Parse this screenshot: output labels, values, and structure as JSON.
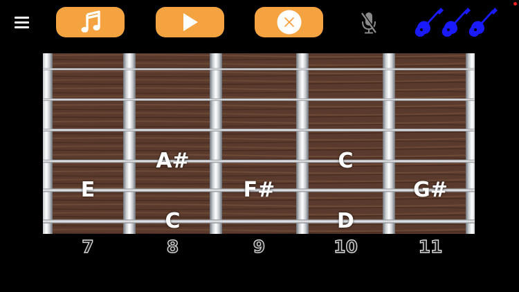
{
  "colors": {
    "accent": "#f4a340",
    "guitar_icons": "#1a1aff",
    "fretboard_wood": "#5a3a2c",
    "background": "#000000",
    "corner_dot": "#ff2222"
  },
  "toolbar": {
    "icons": {
      "menu": "menu-icon",
      "music": "music-note-icon",
      "play": "play-icon",
      "clear": "close-icon",
      "microphone": "microphone-muted-icon",
      "guitars": "electric-guitar-icon"
    }
  },
  "fretboard": {
    "strings": 6,
    "fret_numbers": [
      "7",
      "8",
      "9",
      "10",
      "11"
    ],
    "notes": [
      {
        "label": "A#",
        "fret": 8,
        "string": 4
      },
      {
        "label": "C",
        "fret": 10,
        "string": 4
      },
      {
        "label": "E",
        "fret": 7,
        "string": 5
      },
      {
        "label": "F#",
        "fret": 9,
        "string": 5
      },
      {
        "label": "G#",
        "fret": 11,
        "string": 5
      },
      {
        "label": "C",
        "fret": 8,
        "string": 6
      },
      {
        "label": "D",
        "fret": 10,
        "string": 6
      }
    ]
  }
}
